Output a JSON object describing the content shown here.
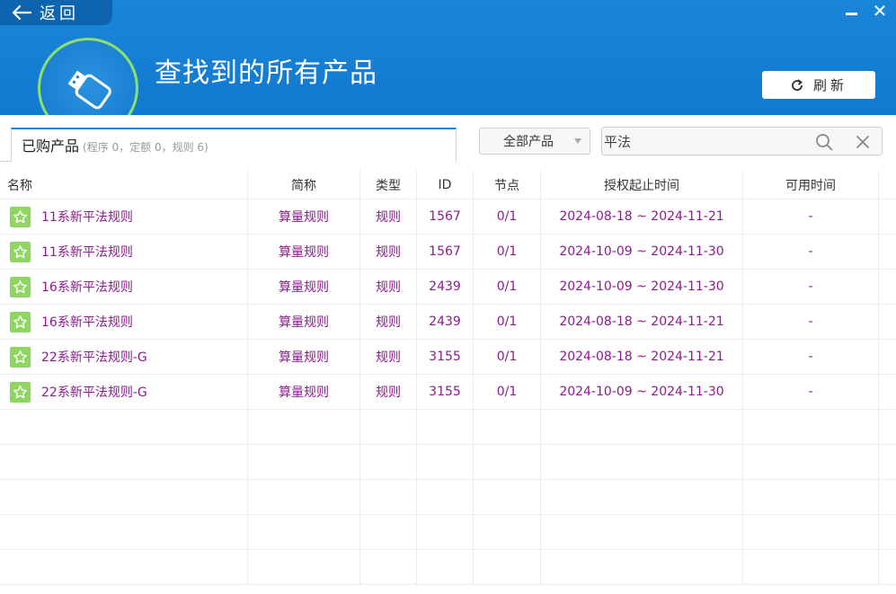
{
  "window": {
    "back_label": "返回"
  },
  "header": {
    "title": "查找到的所有产品",
    "refresh_label": "刷新"
  },
  "toolbar": {
    "tab_label": "已购产品",
    "tab_counts": "(程序 0，定额 0，规则 6)",
    "filter_selected": "全部产品",
    "search_value": "平法"
  },
  "table": {
    "columns": [
      "名称",
      "简称",
      "类型",
      "ID",
      "节点",
      "授权起止时间",
      "可用时间"
    ],
    "rows": [
      {
        "name": "11系新平法规则",
        "short": "算量规则",
        "type": "规则",
        "id": "1567",
        "node": "0/1",
        "period": "2024-08-18 ~ 2024-11-21",
        "avail": "-"
      },
      {
        "name": "11系新平法规则",
        "short": "算量规则",
        "type": "规则",
        "id": "1567",
        "node": "0/1",
        "period": "2024-10-09 ~ 2024-11-30",
        "avail": "-"
      },
      {
        "name": "16系新平法规则",
        "short": "算量规则",
        "type": "规则",
        "id": "2439",
        "node": "0/1",
        "period": "2024-10-09 ~ 2024-11-30",
        "avail": "-"
      },
      {
        "name": "16系新平法规则",
        "short": "算量规则",
        "type": "规则",
        "id": "2439",
        "node": "0/1",
        "period": "2024-08-18 ~ 2024-11-21",
        "avail": "-"
      },
      {
        "name": "22系新平法规则-G",
        "short": "算量规则",
        "type": "规则",
        "id": "3155",
        "node": "0/1",
        "period": "2024-08-18 ~ 2024-11-21",
        "avail": "-"
      },
      {
        "name": "22系新平法规则-G",
        "short": "算量规则",
        "type": "规则",
        "id": "3155",
        "node": "0/1",
        "period": "2024-10-09 ~ 2024-11-30",
        "avail": "-"
      }
    ]
  },
  "colors": {
    "header_blue": "#1079d0",
    "accent_green": "#8ed660",
    "row_text": "#8b1b8e"
  }
}
